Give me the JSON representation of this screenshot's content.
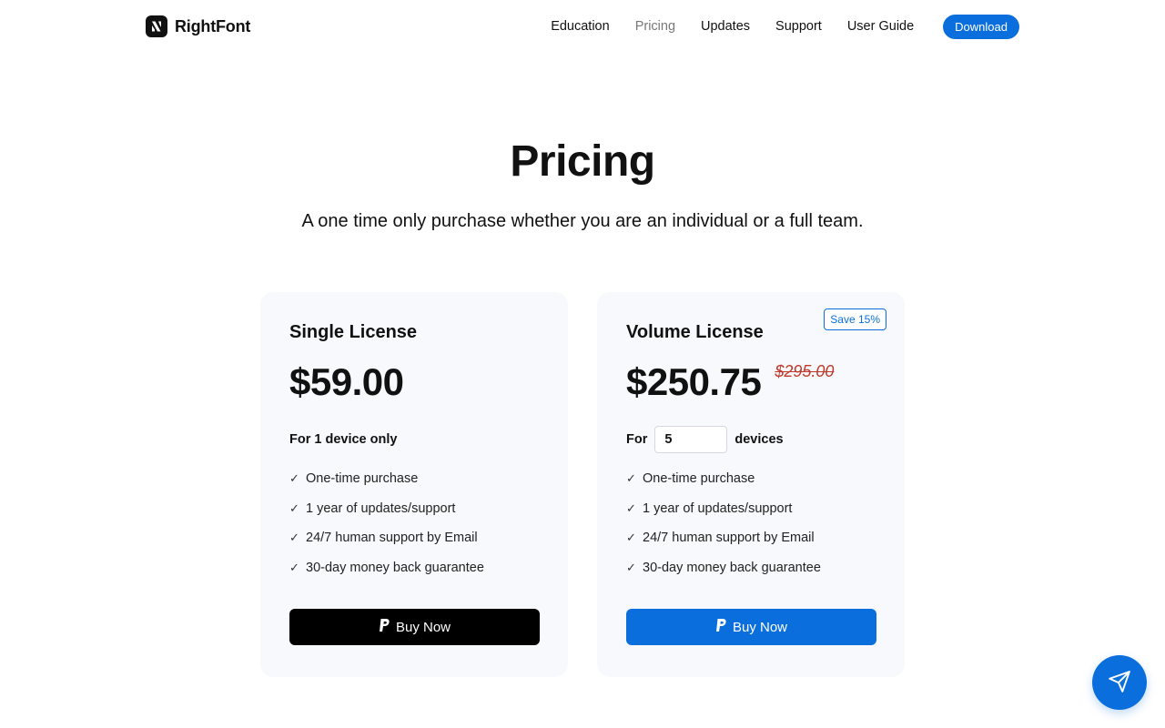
{
  "brand": {
    "name": "RightFont",
    "logo_icon": "rightfont-logo-icon"
  },
  "nav": {
    "items": [
      {
        "label": "Education",
        "active": false
      },
      {
        "label": "Pricing",
        "active": true
      },
      {
        "label": "Updates",
        "active": false
      },
      {
        "label": "Support",
        "active": false
      },
      {
        "label": "User Guide",
        "active": false
      }
    ],
    "download_label": "Download"
  },
  "hero": {
    "title": "Pricing",
    "subtitle": "A one time only purchase whether you are an individual or a full team."
  },
  "plans": {
    "single": {
      "title": "Single License",
      "price": "$59.00",
      "devices_text": "For 1 device only",
      "features": [
        "One-time purchase",
        "1 year of updates/support",
        "24/7 human support by Email",
        "30-day money back guarantee"
      ],
      "button_label": "Buy Now",
      "button_icon": "paypal-icon"
    },
    "volume": {
      "title": "Volume License",
      "badge": "Save 15%",
      "price": "$250.75",
      "old_price": "$295.00",
      "devices_prefix": "For",
      "devices_value": "5",
      "devices_suffix": "devices",
      "features": [
        "One-time purchase",
        "1 year of updates/support",
        "24/7 human support by Email",
        "30-day money back guarantee"
      ],
      "button_label": "Buy Now",
      "button_icon": "paypal-icon"
    }
  },
  "fab": {
    "icon": "send-icon"
  },
  "colors": {
    "accent": "#0a6fdc",
    "strike": "#c0392b",
    "card_bg": "#f8f9fc"
  },
  "check_glyph": "✓"
}
